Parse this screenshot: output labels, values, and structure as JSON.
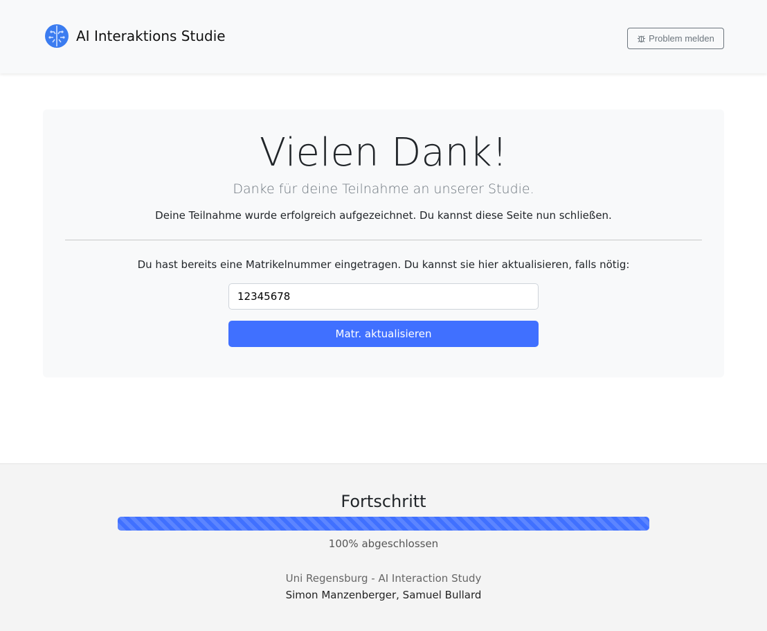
{
  "header": {
    "title": "AI Interaktions Studie",
    "logo_icon": "brain-icon",
    "report_label": "Problem melden",
    "report_icon": "bug-icon"
  },
  "main": {
    "heading": "Vielen Dank!",
    "lead": "Danke für deine Teilnahme an unserer Studie.",
    "message": "Deine Teilnahme wurde erfolgreich aufgezeichnet. Du kannst diese Seite nun schließen.",
    "matr_prompt": "Du hast bereits eine Matrikelnummer eingetragen. Du kannst sie hier aktualisieren, falls nötig:",
    "matr_value": "12345678",
    "update_label": "Matr. aktualisieren"
  },
  "footer": {
    "progress_title": "Fortschritt",
    "progress_percent": 100,
    "progress_text": "100% abgeschlossen",
    "institution": "Uni Regensburg - AI Interaction Study",
    "authors": "Simon Manzenberger, Samuel Bullard"
  },
  "colors": {
    "accent": "#4070ff"
  }
}
